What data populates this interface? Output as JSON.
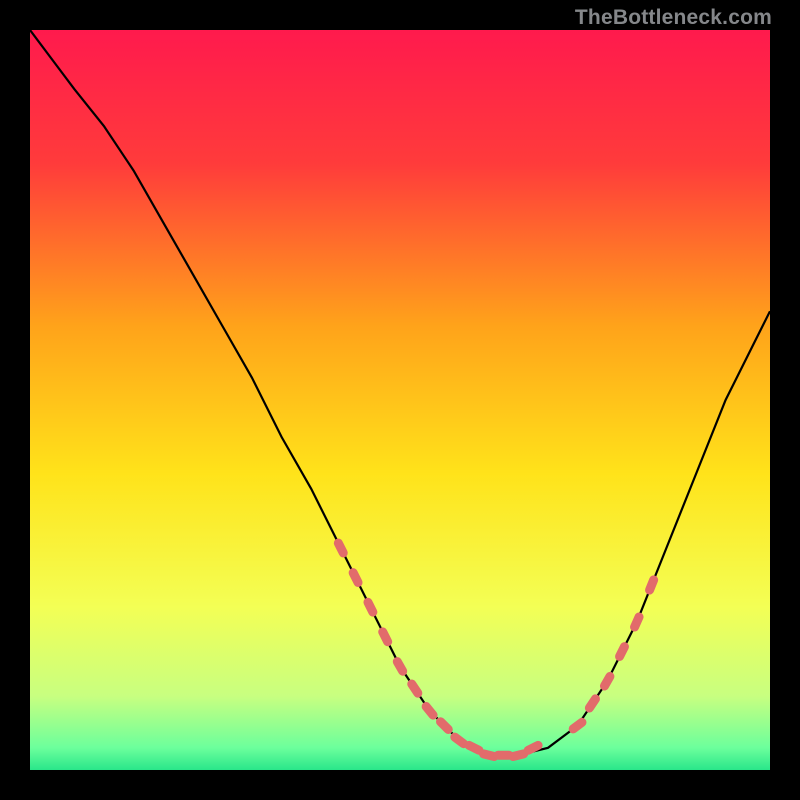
{
  "watermark": "TheBottleneck.com",
  "chart_data": {
    "type": "line",
    "title": "",
    "xlabel": "",
    "ylabel": "",
    "xlim": [
      0,
      100
    ],
    "ylim": [
      0,
      100
    ],
    "gradient_stops": [
      {
        "offset": 0,
        "color": "#ff1a4d"
      },
      {
        "offset": 18,
        "color": "#ff3b3b"
      },
      {
        "offset": 40,
        "color": "#ffa31a"
      },
      {
        "offset": 60,
        "color": "#ffe31a"
      },
      {
        "offset": 78,
        "color": "#f3ff55"
      },
      {
        "offset": 90,
        "color": "#c8ff80"
      },
      {
        "offset": 97,
        "color": "#6cff9c"
      },
      {
        "offset": 100,
        "color": "#29e68a"
      }
    ],
    "series": [
      {
        "name": "bottleneck-curve",
        "x": [
          0,
          3,
          6,
          10,
          14,
          18,
          22,
          26,
          30,
          34,
          38,
          42,
          46,
          50,
          54,
          58,
          62,
          66,
          70,
          74,
          78,
          82,
          86,
          90,
          94,
          98,
          100
        ],
        "y": [
          100,
          96,
          92,
          87,
          81,
          74,
          67,
          60,
          53,
          45,
          38,
          30,
          22,
          14,
          8,
          4,
          2,
          2,
          3,
          6,
          12,
          20,
          30,
          40,
          50,
          58,
          62
        ]
      }
    ],
    "markers": {
      "name": "highlight-segments",
      "color": "#e26b6b",
      "points": [
        {
          "x": 42,
          "y": 30
        },
        {
          "x": 44,
          "y": 26
        },
        {
          "x": 46,
          "y": 22
        },
        {
          "x": 48,
          "y": 18
        },
        {
          "x": 50,
          "y": 14
        },
        {
          "x": 52,
          "y": 11
        },
        {
          "x": 54,
          "y": 8
        },
        {
          "x": 56,
          "y": 6
        },
        {
          "x": 58,
          "y": 4
        },
        {
          "x": 60,
          "y": 3
        },
        {
          "x": 62,
          "y": 2
        },
        {
          "x": 64,
          "y": 2
        },
        {
          "x": 66,
          "y": 2
        },
        {
          "x": 68,
          "y": 3
        },
        {
          "x": 74,
          "y": 6
        },
        {
          "x": 76,
          "y": 9
        },
        {
          "x": 78,
          "y": 12
        },
        {
          "x": 80,
          "y": 16
        },
        {
          "x": 82,
          "y": 20
        },
        {
          "x": 84,
          "y": 25
        }
      ]
    }
  }
}
